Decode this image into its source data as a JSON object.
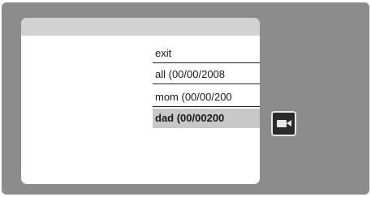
{
  "menu": {
    "items": [
      {
        "label": "exit"
      },
      {
        "label": "all (00/00/2008"
      },
      {
        "label": "mom (00/00/200"
      },
      {
        "label": "dad (00/00200"
      }
    ],
    "selected_index": 3
  },
  "icons": {
    "camera": "video-camera-icon"
  },
  "colors": {
    "device_background": "#8c8c8c",
    "panel_header": "#d2d2d2",
    "selected_row": "#c8c8c8",
    "camera_button": "#2a2a2a"
  }
}
